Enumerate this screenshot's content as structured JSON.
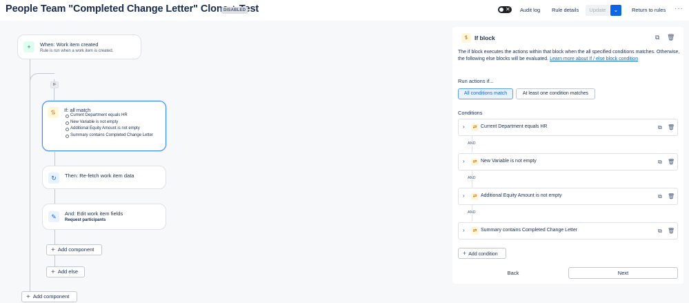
{
  "header": {
    "title": "People Team \"Completed Change Letter\" Clone + Test",
    "status_badge": "DISABLED",
    "audit_log": "Audit log",
    "rule_details": "Rule details",
    "update": "Update",
    "return_to_rules": "Return to rules",
    "more": "···"
  },
  "canvas": {
    "trigger": {
      "title": "When: Work item created",
      "subtitle": "Rule is run when a work item is created.",
      "icon": "plus-icon"
    },
    "if_chip": "IF",
    "if_block": {
      "title": "If: all match",
      "conditions": [
        "Current Department equals HR",
        "New Variable is not empty",
        "Additional Equity Amount is not empty",
        "Summary contains Completed Change Letter"
      ],
      "icon": "branch-icon"
    },
    "then_block": {
      "title": "Then: Re-fetch work item data",
      "icon": "refresh-icon"
    },
    "and_block": {
      "title": "And: Edit work item fields",
      "subtitle": "Request participants",
      "icon": "edit-icon"
    },
    "add_component_inner": "Add component",
    "add_else": "Add else",
    "add_component_outer": "Add component"
  },
  "panel": {
    "title": "If block",
    "description": "The if block executes the actions within that block when the all specified conditions matches. Otherwise, the following else blocks will be evaluated. ",
    "learn_more": "Learn more about If / else block condition",
    "run_actions_label": "Run actions if...",
    "options": [
      "All conditions match",
      "At least one condition matches"
    ],
    "selected_option": "All conditions match",
    "conditions_label": "Conditions",
    "conditions": [
      "Current Department equals HR",
      "New Variable is not empty",
      "Additional Equity Amount is not empty",
      "Summary contains Completed Change Letter"
    ],
    "and_label": "AND",
    "add_condition": "Add condition",
    "back": "Back",
    "next": "Next"
  },
  "colors": {
    "accent": "#0c66e4",
    "selected_border": "#388bff",
    "trigger_icon_bg": "#dcfff1",
    "condition_icon_bg": "#fff7d6",
    "action_icon_bg": "#e9f2ff"
  }
}
